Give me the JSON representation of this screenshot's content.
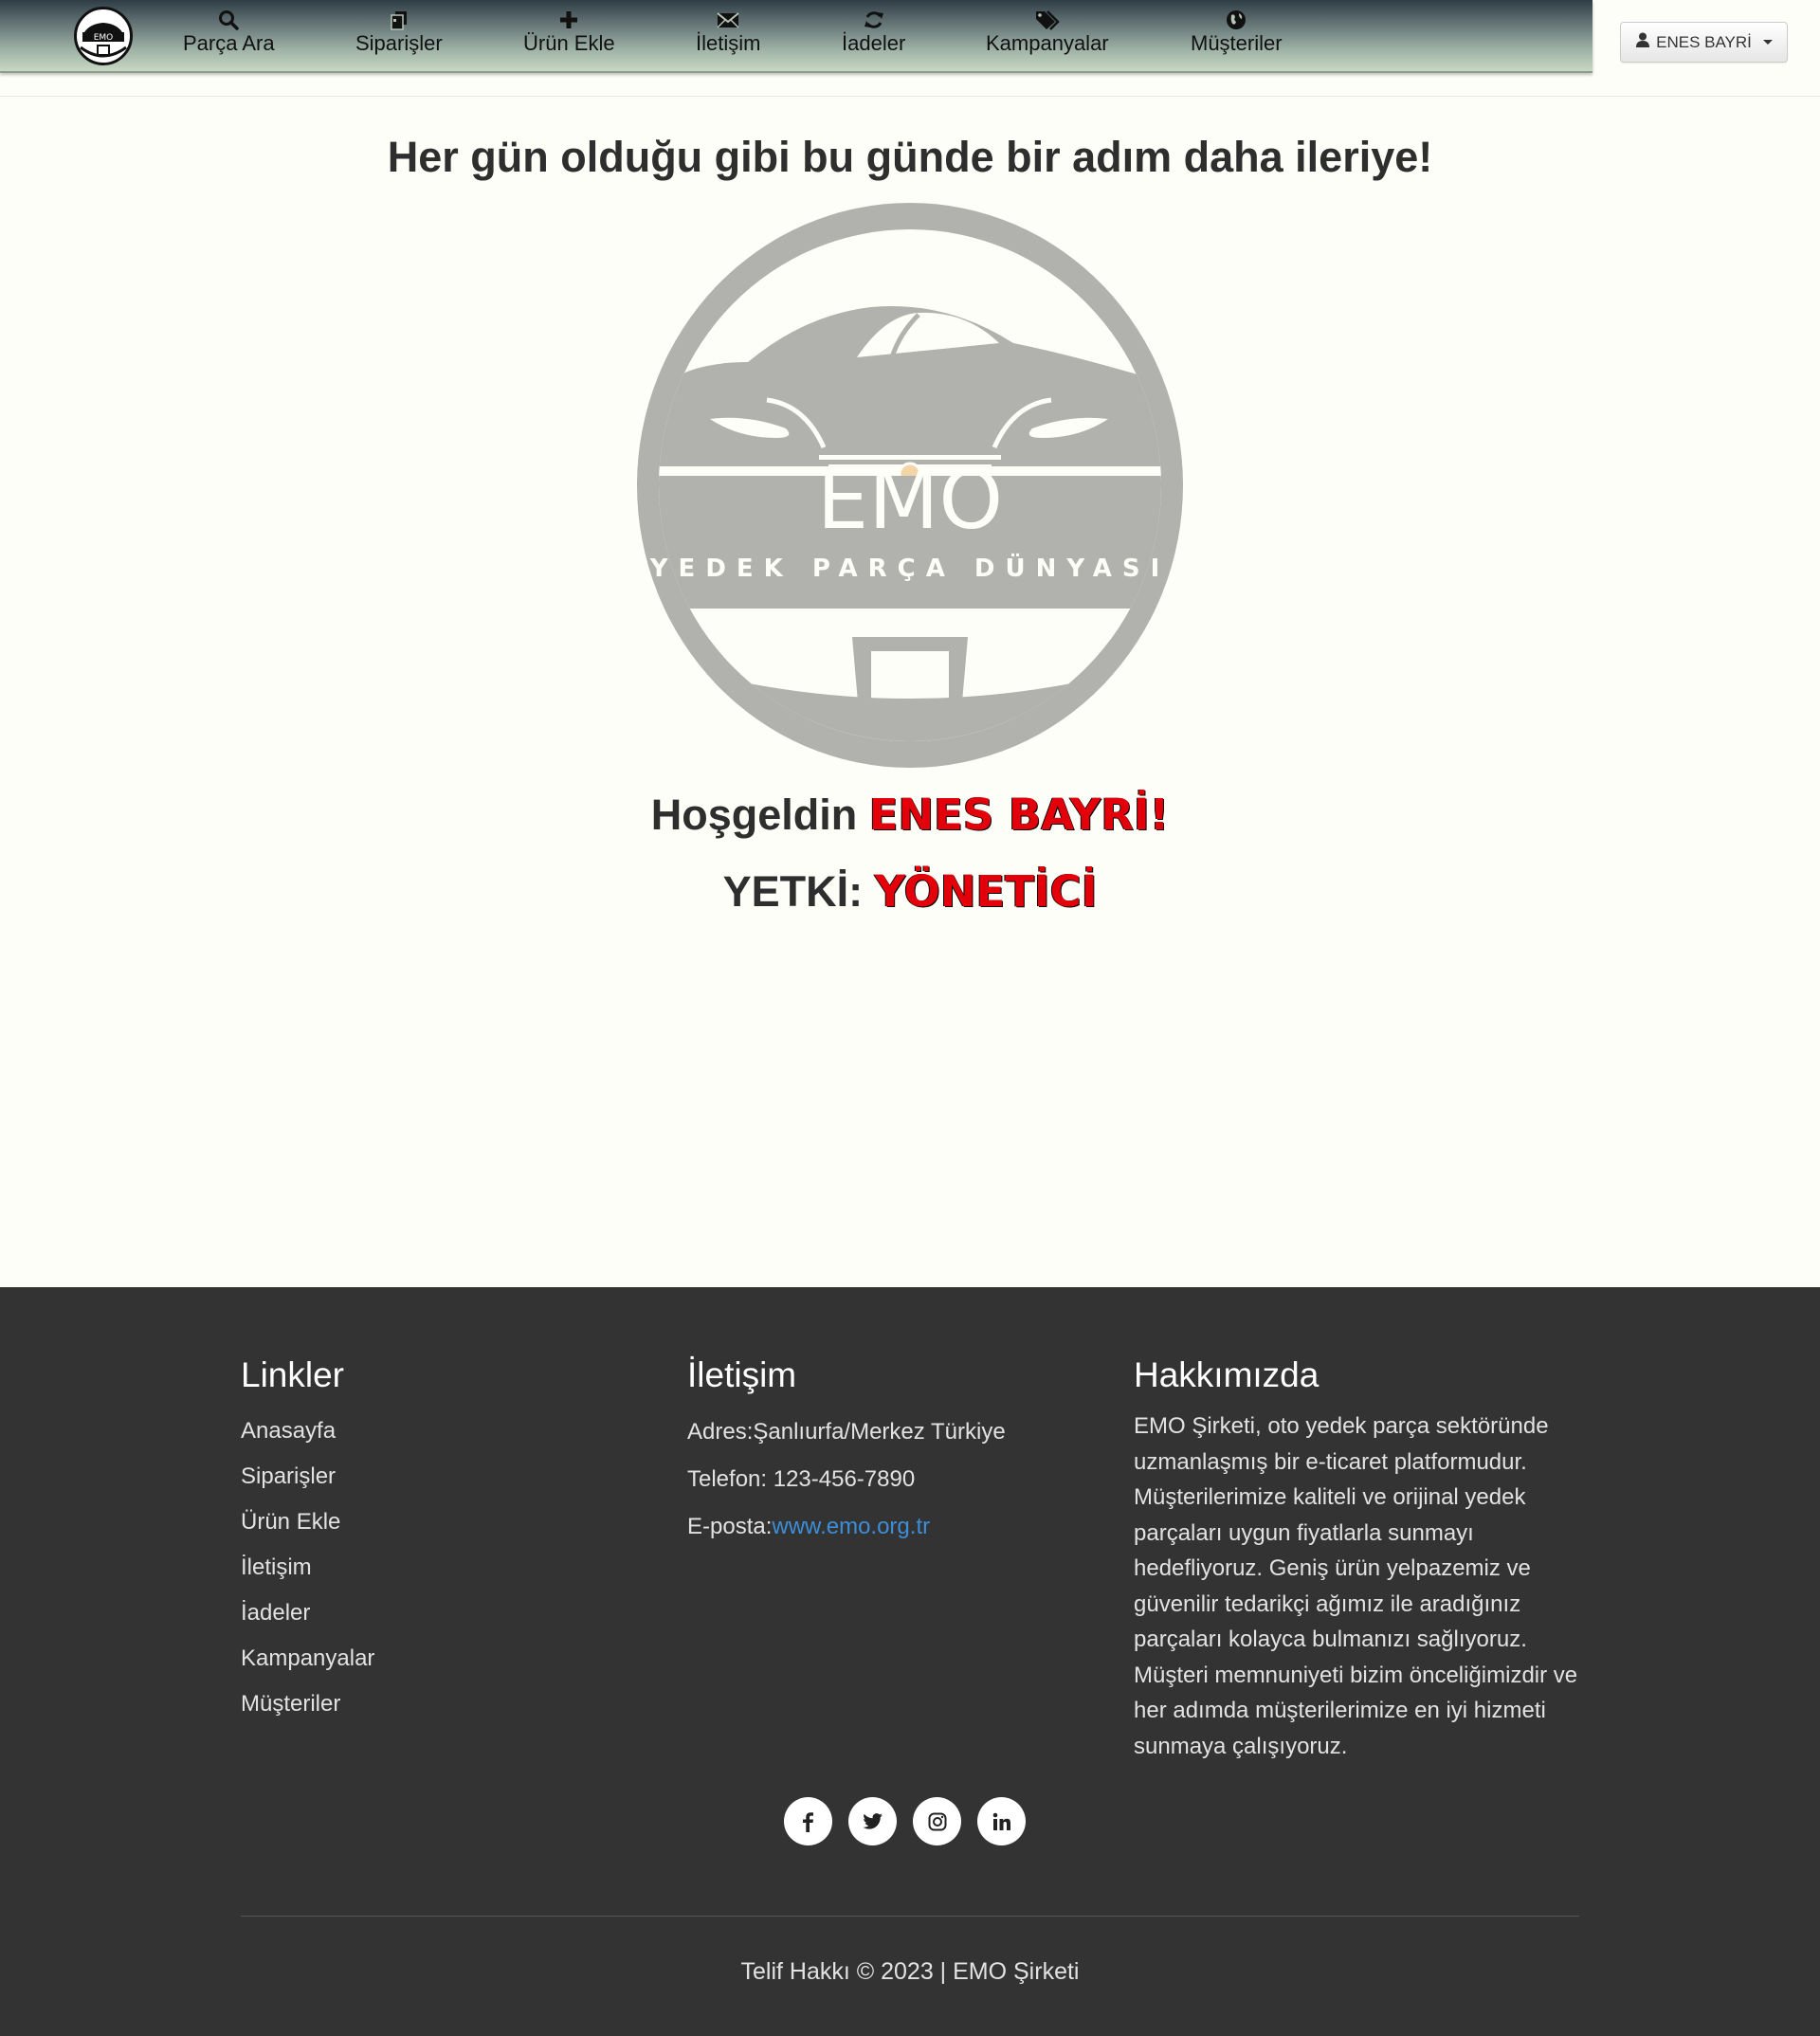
{
  "nav": {
    "logo_text": "EMO",
    "items": [
      {
        "label": "Parça Ara",
        "icon": "search-icon"
      },
      {
        "label": "Siparişler",
        "icon": "files-icon"
      },
      {
        "label": "Ürün Ekle",
        "icon": "plus-icon"
      },
      {
        "label": "İletişim",
        "icon": "envelope-icon"
      },
      {
        "label": "İadeler",
        "icon": "refresh-icon"
      },
      {
        "label": "Kampanyalar",
        "icon": "tags-icon"
      },
      {
        "label": "Müşteriler",
        "icon": "globe-icon"
      }
    ],
    "user_label": "ENES BAYRİ"
  },
  "main": {
    "headline": "Her gün olduğu gibi bu günde bir adım daha ileriye!",
    "logo": {
      "brand": "EMO",
      "tagline": "YEDEK PARÇA DÜNYASI"
    },
    "welcome_prefix": "Hoşgeldin",
    "welcome_name": "ENES BAYRİ!",
    "role_prefix": "YETKİ:",
    "role_value": "YÖNETİCİ"
  },
  "footer": {
    "links_title": "Linkler",
    "links": [
      "Anasayfa",
      "Siparişler",
      "Ürün Ekle",
      "İletişim",
      "İadeler",
      "Kampanyalar",
      "Müşteriler"
    ],
    "contact_title": "İletişim",
    "address": "Adres:Şanlıurfa/Merkez Türkiye",
    "phone": "Telefon: 123-456-7890",
    "email_prefix": "E-posta:",
    "email_link": "www.emo.org.tr",
    "about_title": "Hakkımızda",
    "about_text": "EMO Şirketi, oto yedek parça sektöründe uzmanlaşmış bir e-ticaret platformudur. Müşterilerimize kaliteli ve orijinal yedek parçaları uygun fiyatlarla sunmayı hedefliyoruz. Geniş ürün yelpazemiz ve güvenilir tedarikçi ağımız ile aradığınız parçaları kolayca bulmanızı sağlıyoruz. Müşteri memnuniyeti bizim önceliğimizdir ve her adımda müşterilerimize en iyi hizmeti sunmaya çalışıyoruz.",
    "socials": [
      "facebook-icon",
      "twitter-icon",
      "instagram-icon",
      "linkedin-icon"
    ],
    "copyright": "Telif Hakkı © 2023 | EMO Şirketi"
  },
  "colors": {
    "accent_red": "#e3000b",
    "footer_bg": "#333333",
    "page_bg": "#fcfef7",
    "link_blue": "#3d8ed8"
  }
}
